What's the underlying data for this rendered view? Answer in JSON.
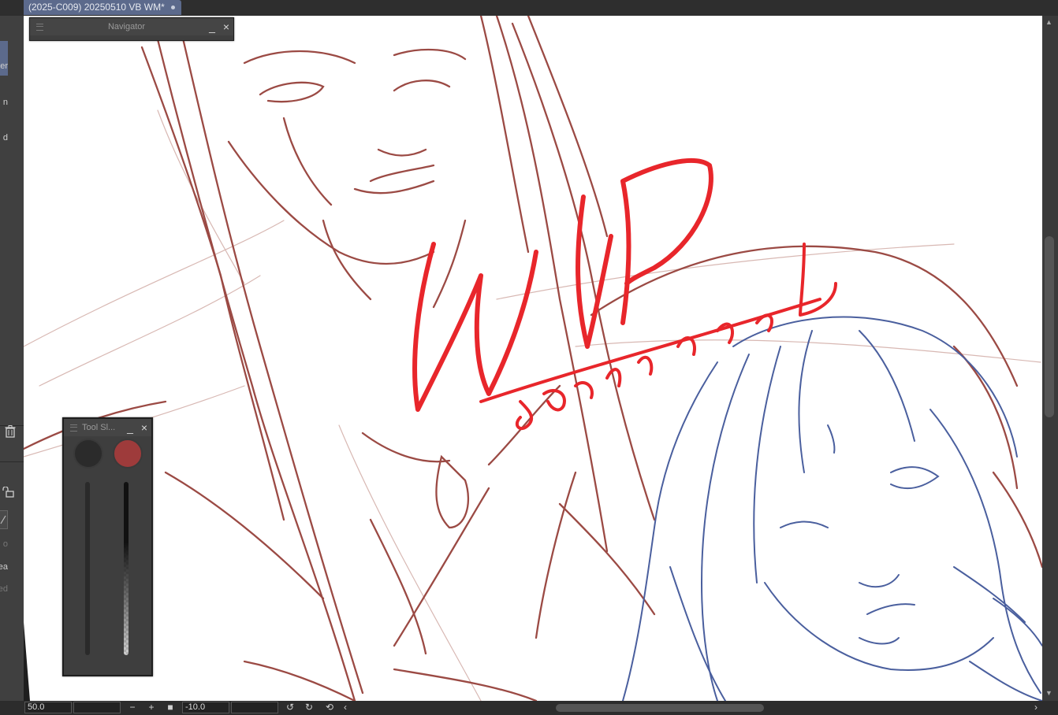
{
  "document_tab": {
    "title": "(2025-C009) 20250510 VB WM*"
  },
  "left_panel": {
    "truncated_labels": [
      "er",
      "n",
      "d",
      "o",
      "ea",
      "ed"
    ]
  },
  "navigator": {
    "title": "Navigator",
    "minimize": "_",
    "close": "×"
  },
  "tool_slider": {
    "title": "Tool Sl...",
    "minimize": "_",
    "close": "×",
    "colors": {
      "main": "#2b2b2b",
      "sub": "#9e3b3b"
    }
  },
  "watermark": {
    "text": "WIP",
    "signature": "sountoaldol",
    "color": "#e8262b"
  },
  "sketch_colors": {
    "man": "#9b4a44",
    "woman": "#4a5f9e"
  },
  "status_bar": {
    "zoom": "50.0",
    "zoom_out": "−",
    "zoom_in": "+",
    "rotation": "-10.0"
  }
}
